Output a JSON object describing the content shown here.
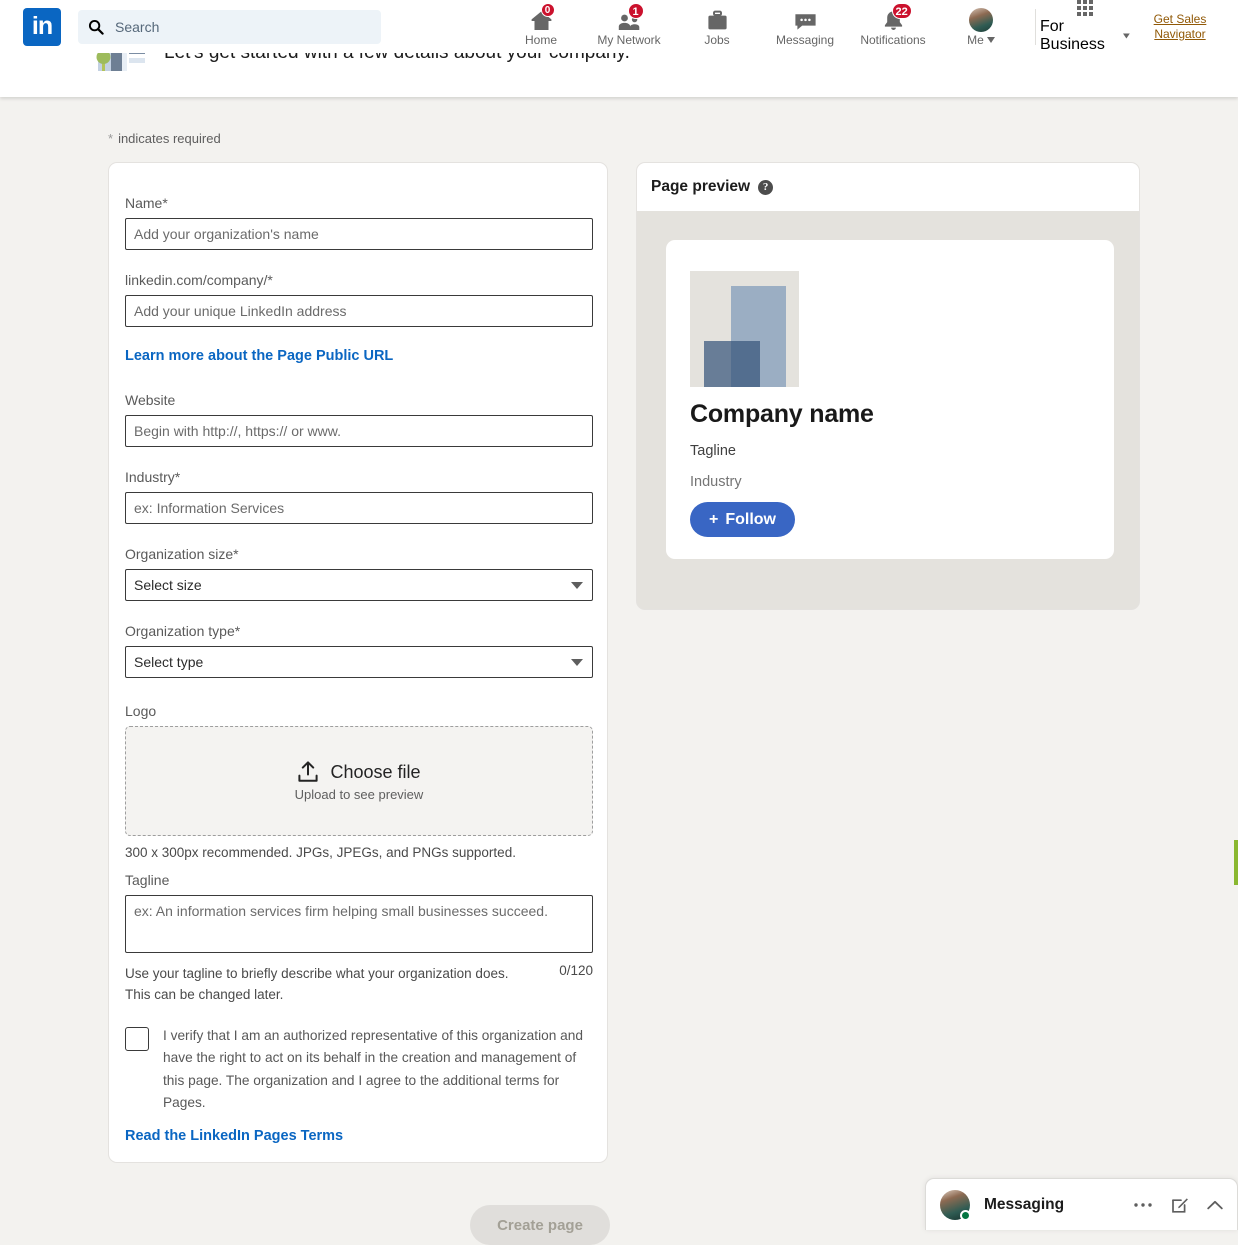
{
  "nav": {
    "logo_alt": "linkedin-logo",
    "search": {
      "value": "",
      "placeholder": "Search"
    },
    "items": [
      {
        "label": "Home",
        "icon": "home-icon",
        "badge": "0"
      },
      {
        "label": "My Network",
        "icon": "network-icon",
        "badge": "1"
      },
      {
        "label": "Jobs",
        "icon": "briefcase-icon",
        "badge": ""
      },
      {
        "label": "Messaging",
        "icon": "message-bubble-icon",
        "badge": ""
      },
      {
        "label": "Notifications",
        "icon": "bell-icon",
        "badge": "22"
      },
      {
        "label": "Me",
        "icon": "avatar-icon",
        "badge": ""
      }
    ],
    "for_business": "For Business",
    "sales_navigator_line1": "Get Sales",
    "sales_navigator_line2": "Navigator"
  },
  "sub_header": {
    "title": "Let's get started with a few details about your company."
  },
  "required_note": {
    "star": "*",
    "text": "indicates required"
  },
  "form": {
    "name": {
      "label": "Name*",
      "value": "",
      "placeholder": "Add your organization's name"
    },
    "public_url": {
      "label": "linkedin.com/company/*",
      "value": "",
      "placeholder": "Add your unique LinkedIn address"
    },
    "public_url_link": "Learn more about the Page Public URL",
    "website": {
      "label": "Website",
      "value": "",
      "placeholder": "Begin with http://, https:// or www."
    },
    "industry": {
      "label": "Industry*",
      "value": "",
      "placeholder": "ex: Information Services"
    },
    "org_size": {
      "label": "Organization size*",
      "selected": "Select size"
    },
    "org_type": {
      "label": "Organization type*",
      "selected": "Select type"
    },
    "logo": {
      "label": "Logo",
      "choose_file": "Choose file",
      "upload_hint": "Upload to see preview",
      "note": "300 x 300px recommended. JPGs, JPEGs, and PNGs supported."
    },
    "tagline": {
      "label": "Tagline",
      "value": "",
      "placeholder": "ex: An information services firm helping small businesses succeed.",
      "help": "Use your tagline to briefly describe what your organization does. This can be changed later.",
      "counter": "0/120"
    },
    "verify": {
      "checked": false,
      "text": "I verify that I am an authorized representative of this organization and have the right to act on its behalf in the creation and management of this page. The organization and I agree to the additional terms for Pages.",
      "terms_link": "Read the LinkedIn Pages Terms"
    },
    "submit_label": "Create page"
  },
  "preview": {
    "panel_title": "Page preview",
    "help_glyph": "?",
    "company_name": "Company name",
    "tagline": "Tagline",
    "industry": "Industry",
    "follow_label": "Follow",
    "follow_plus": "+"
  },
  "messaging_dock": {
    "label": "Messaging",
    "more_glyph": "•••",
    "compose_icon": "compose-icon",
    "chevron_icon": "chevron-up-icon"
  },
  "colors": {
    "brand_blue": "#0a66c2",
    "follow_blue": "#3966c4",
    "badge_red": "#cb112d",
    "page_bg": "#f3f2ef",
    "preview_bg": "#e4e2dd",
    "sales_nav": "#915907",
    "presence_green": "#057642",
    "strip_green": "#8ab830"
  }
}
